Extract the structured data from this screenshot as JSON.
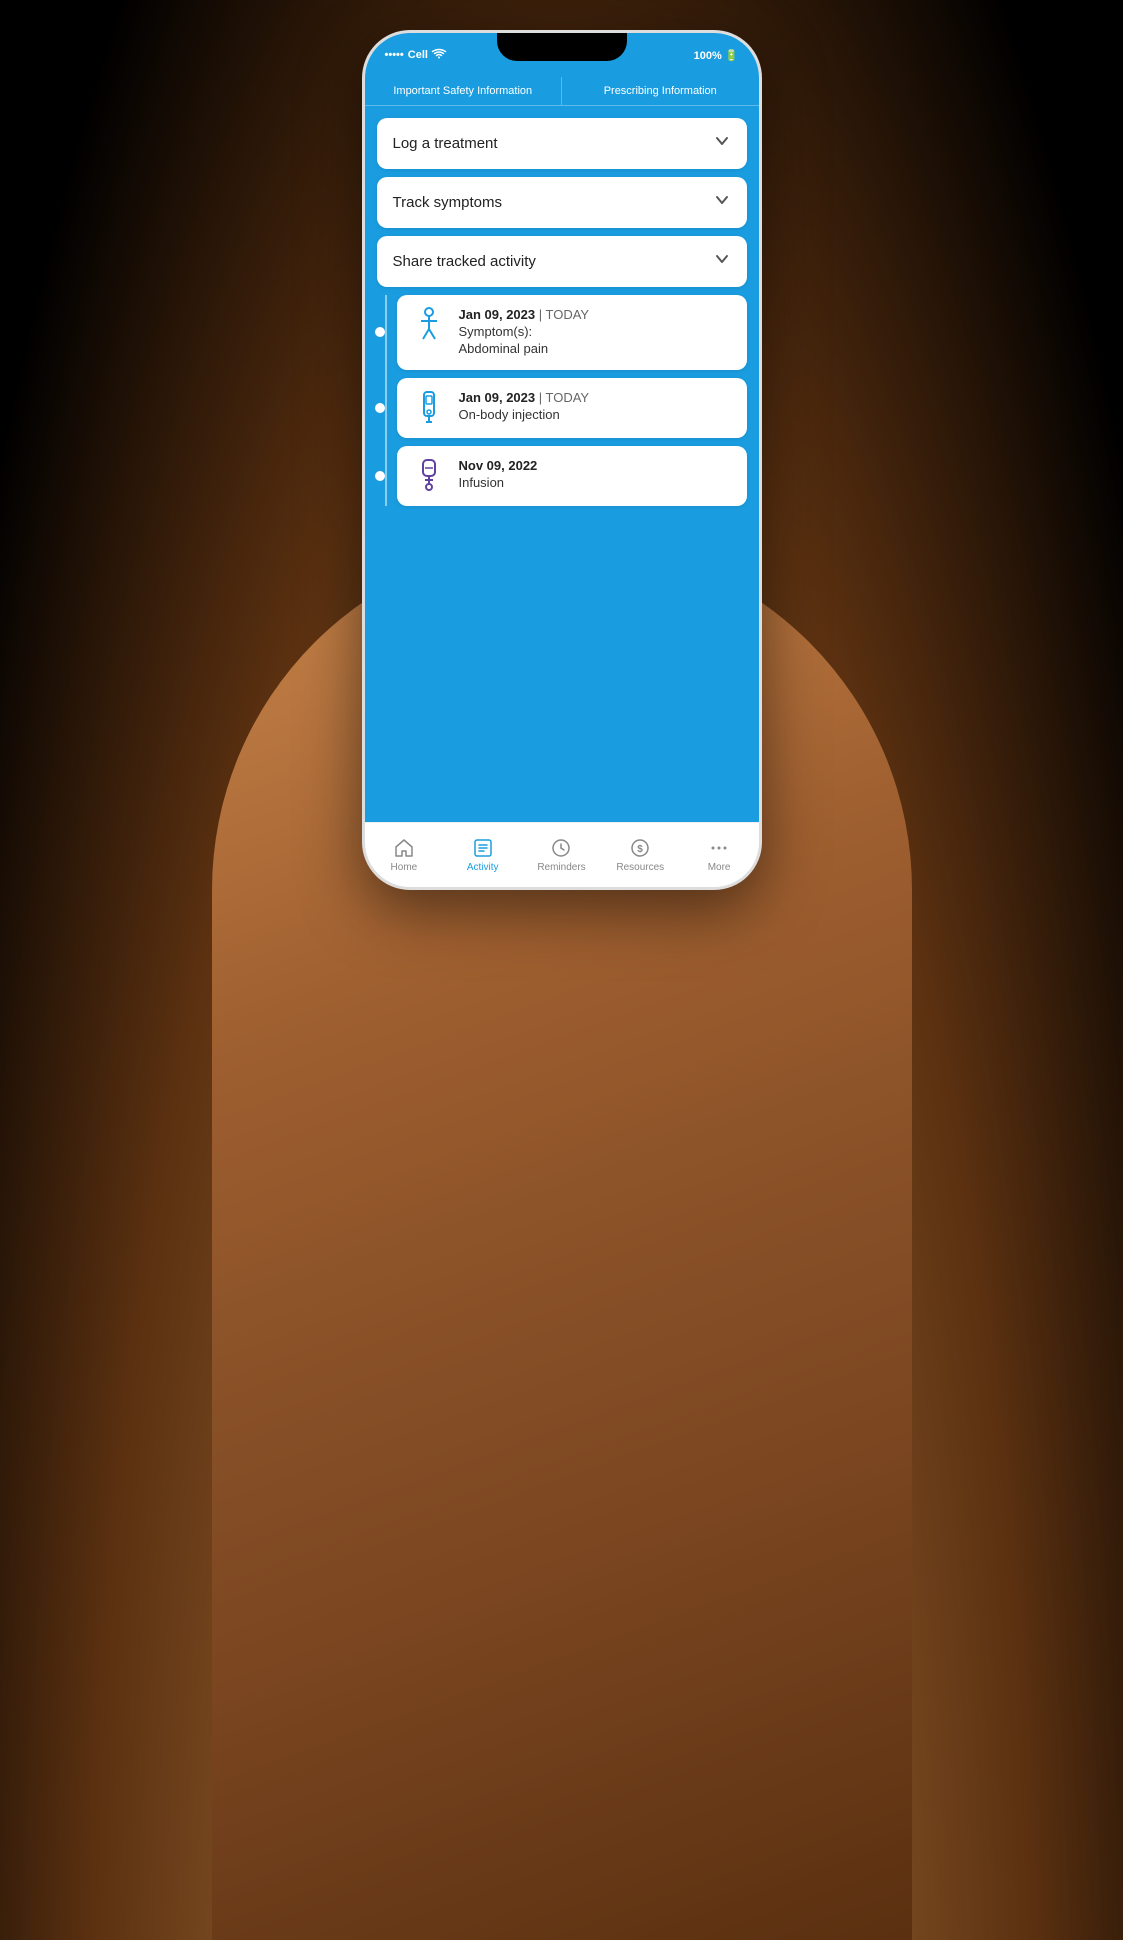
{
  "status_bar": {
    "carrier": "Cell",
    "battery": "100%",
    "wifi_symbol": "⌔"
  },
  "header_tabs": [
    {
      "id": "safety-info",
      "label": "Important Safety Information"
    },
    {
      "id": "prescribing-info",
      "label": "Prescribing Information"
    }
  ],
  "accordion": {
    "items": [
      {
        "id": "log-treatment",
        "label": "Log a treatment"
      },
      {
        "id": "track-symptoms",
        "label": "Track symptoms"
      },
      {
        "id": "share-activity",
        "label": "Share tracked activity"
      }
    ]
  },
  "timeline": {
    "entries": [
      {
        "id": "entry-1",
        "date": "Jan 09, 2023",
        "date_suffix": "| TODAY",
        "line1": "Symptom(s):",
        "line2": "Abdominal pain",
        "icon_type": "person"
      },
      {
        "id": "entry-2",
        "date": "Jan 09, 2023",
        "date_suffix": "| TODAY",
        "line1": "On-body injection",
        "line2": "",
        "icon_type": "injector"
      },
      {
        "id": "entry-3",
        "date": "Nov 09, 2022",
        "date_suffix": "",
        "line1": "Infusion",
        "line2": "",
        "icon_type": "infusion"
      }
    ]
  },
  "bottom_nav": {
    "items": [
      {
        "id": "home",
        "label": "Home",
        "icon": "home",
        "active": false
      },
      {
        "id": "activity",
        "label": "Activity",
        "icon": "list",
        "active": true
      },
      {
        "id": "reminders",
        "label": "Reminders",
        "icon": "clock",
        "active": false
      },
      {
        "id": "resources",
        "label": "Resources",
        "icon": "dollar",
        "active": false
      },
      {
        "id": "more",
        "label": "More",
        "icon": "dots",
        "active": false
      }
    ]
  }
}
